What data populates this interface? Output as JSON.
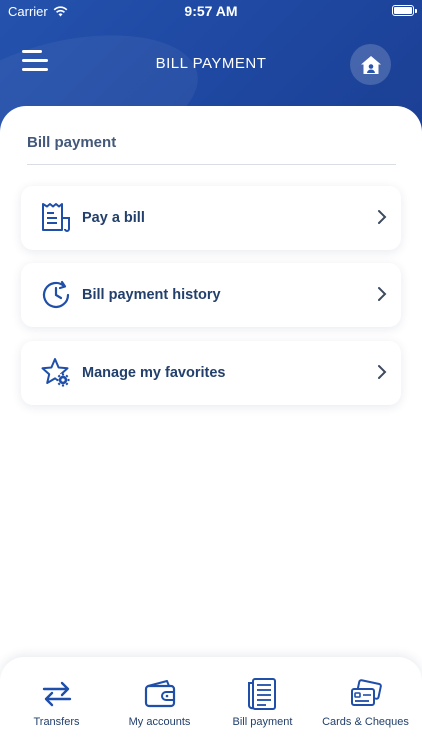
{
  "status_bar": {
    "carrier": "Carrier",
    "time": "9:57 AM"
  },
  "header": {
    "title": "BILL PAYMENT",
    "menu_icon": "hamburger-menu-icon",
    "home_icon": "home-icon"
  },
  "section": {
    "title": "Bill payment"
  },
  "options": [
    {
      "label": "Pay a bill",
      "icon": "bill-icon"
    },
    {
      "label": "Bill payment history",
      "icon": "history-clock-icon"
    },
    {
      "label": "Manage my favorites",
      "icon": "star-gear-icon"
    }
  ],
  "bottom_nav": [
    {
      "label": "Transfers",
      "icon": "transfer-arrows-icon"
    },
    {
      "label": "My accounts",
      "icon": "wallet-icon"
    },
    {
      "label": "Bill payment",
      "icon": "bill-scroll-icon"
    },
    {
      "label": "Cards & Cheques",
      "icon": "cards-icon"
    }
  ],
  "colors": {
    "header_bg": "#1f49a3",
    "accent": "#23406c",
    "icon": "#1f4fa8"
  }
}
